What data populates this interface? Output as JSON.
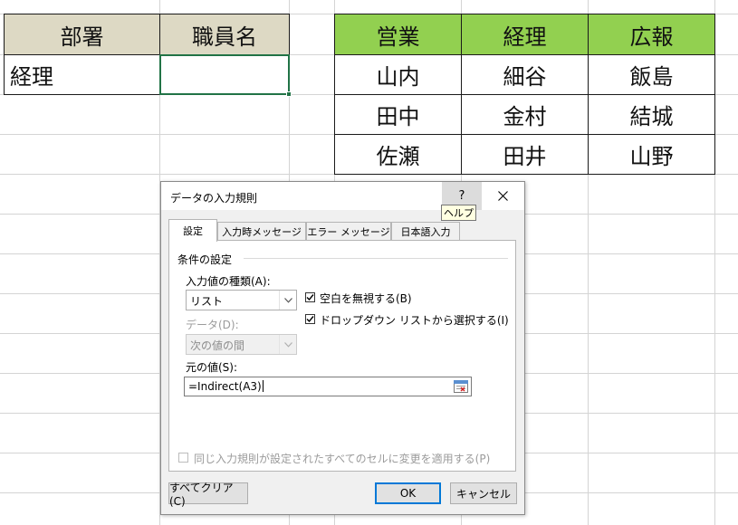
{
  "sheet": {
    "dept_table": {
      "headers": [
        "部署",
        "職員名"
      ],
      "row": [
        "経理",
        ""
      ]
    },
    "staff_table": {
      "headers": [
        "営業",
        "経理",
        "広報"
      ],
      "rows": [
        [
          "山内",
          "細谷",
          "飯島"
        ],
        [
          "田中",
          "金村",
          "結城"
        ],
        [
          "佐瀬",
          "田井",
          "山野"
        ]
      ]
    },
    "colors": {
      "tan_header": "#ddd9c4",
      "green_header": "#92d050",
      "selection": "#217346"
    }
  },
  "dialog": {
    "title": "データの入力規則",
    "help_label": "?",
    "help_tooltip": "ヘルプ",
    "close_icon": "close-icon",
    "tabs": [
      "設定",
      "入力時メッセージ",
      "エラー メッセージ",
      "日本語入力"
    ],
    "active_tab": "設定",
    "section_title": "条件の設定",
    "allow_label": "入力値の種類(A):",
    "allow_value": "リスト",
    "data_label": "データ(D):",
    "data_value": "次の値の間",
    "ignore_blank_label": "空白を無視する(B)",
    "dropdown_label": "ドロップダウン リストから選択する(I)",
    "source_label": "元の値(S):",
    "source_value": "=Indirect(A3)",
    "apply_all_label": "同じ入力規則が設定されたすべてのセルに変更を適用する(P)",
    "clear_all_label": "すべてクリア(C)",
    "ok_label": "OK",
    "cancel_label": "キャンセル"
  }
}
